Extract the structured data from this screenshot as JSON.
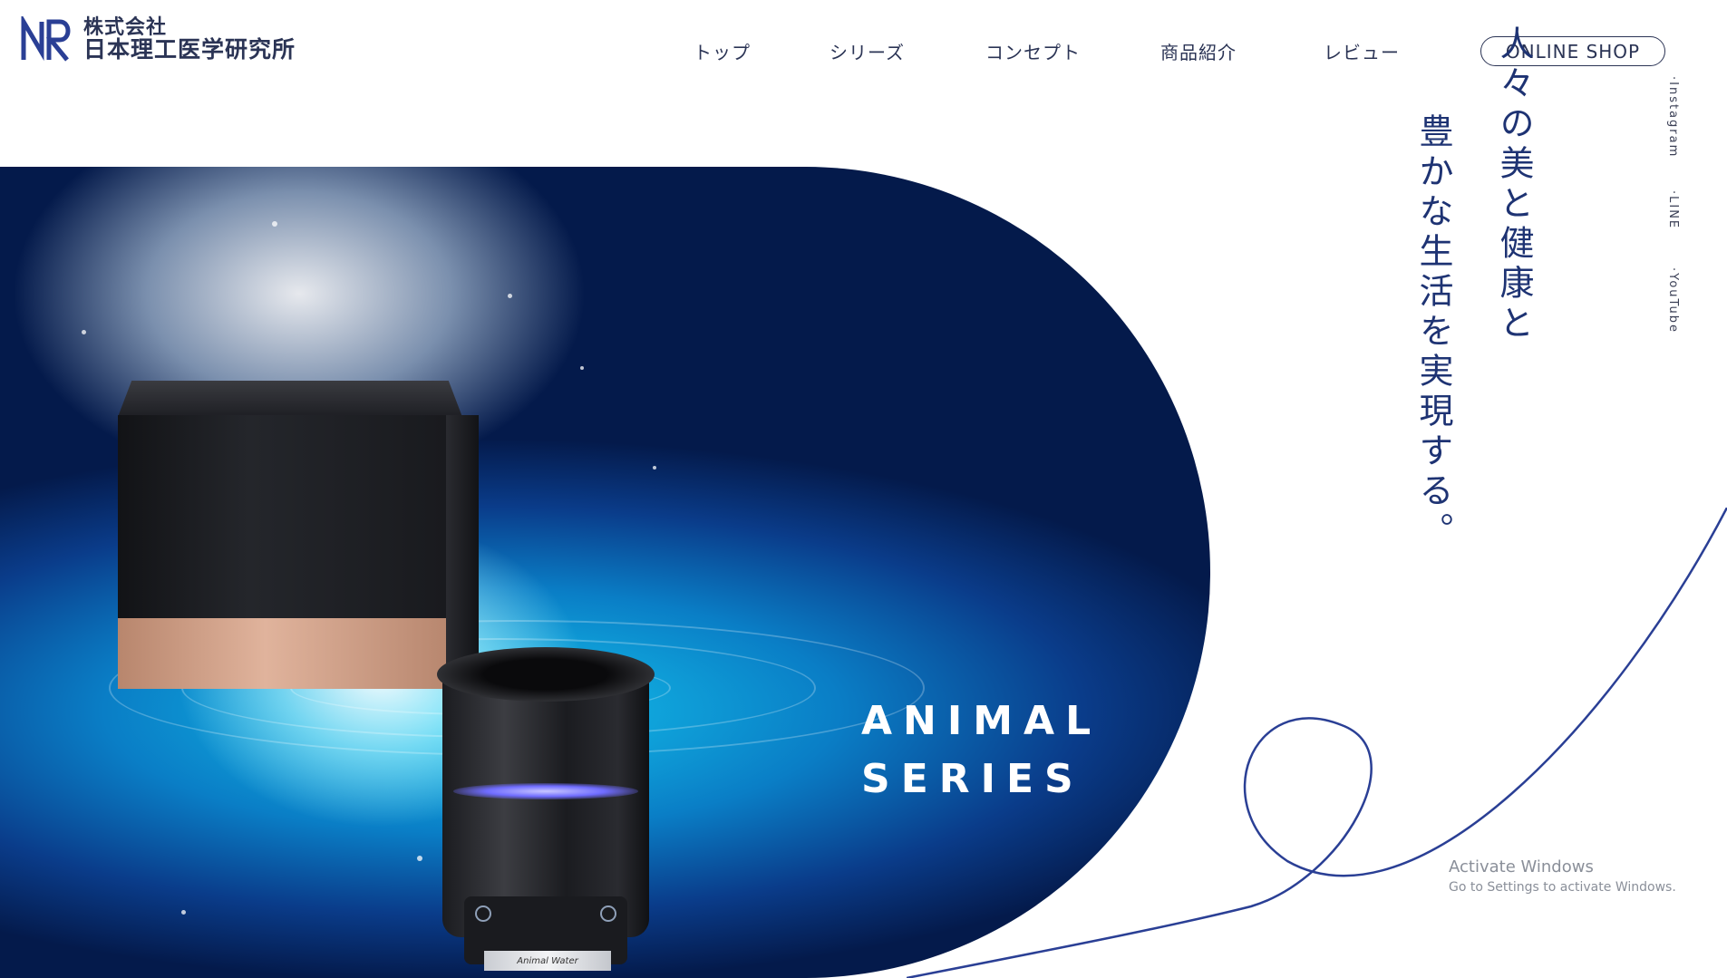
{
  "logo": {
    "brand_mark": "NR",
    "line1": "株式会社",
    "line2": "日本理工医学研究所"
  },
  "nav": {
    "items": [
      {
        "label": "トップ"
      },
      {
        "label": "シリーズ"
      },
      {
        "label": "コンセプト"
      },
      {
        "label": "商品紹介"
      },
      {
        "label": "レビュー"
      }
    ],
    "shop_button": "ONLINE SHOP"
  },
  "hero": {
    "title_line1": "ANIMAL",
    "title_line2": "SERIES",
    "product_label": "Animal Water"
  },
  "catch_copy": {
    "line1": "人々の美と健康と",
    "line2": "豊かな生活を実現する。"
  },
  "social": {
    "instagram": "·Instagram",
    "line": "·LINE",
    "youtube": "·YouTube"
  },
  "watermark": {
    "title": "Activate Windows",
    "subtitle": "Go to Settings to activate Windows."
  },
  "colors": {
    "brand_navy": "#1e3373",
    "text_dark": "#2b3455",
    "line_blue": "#2a3f95"
  }
}
